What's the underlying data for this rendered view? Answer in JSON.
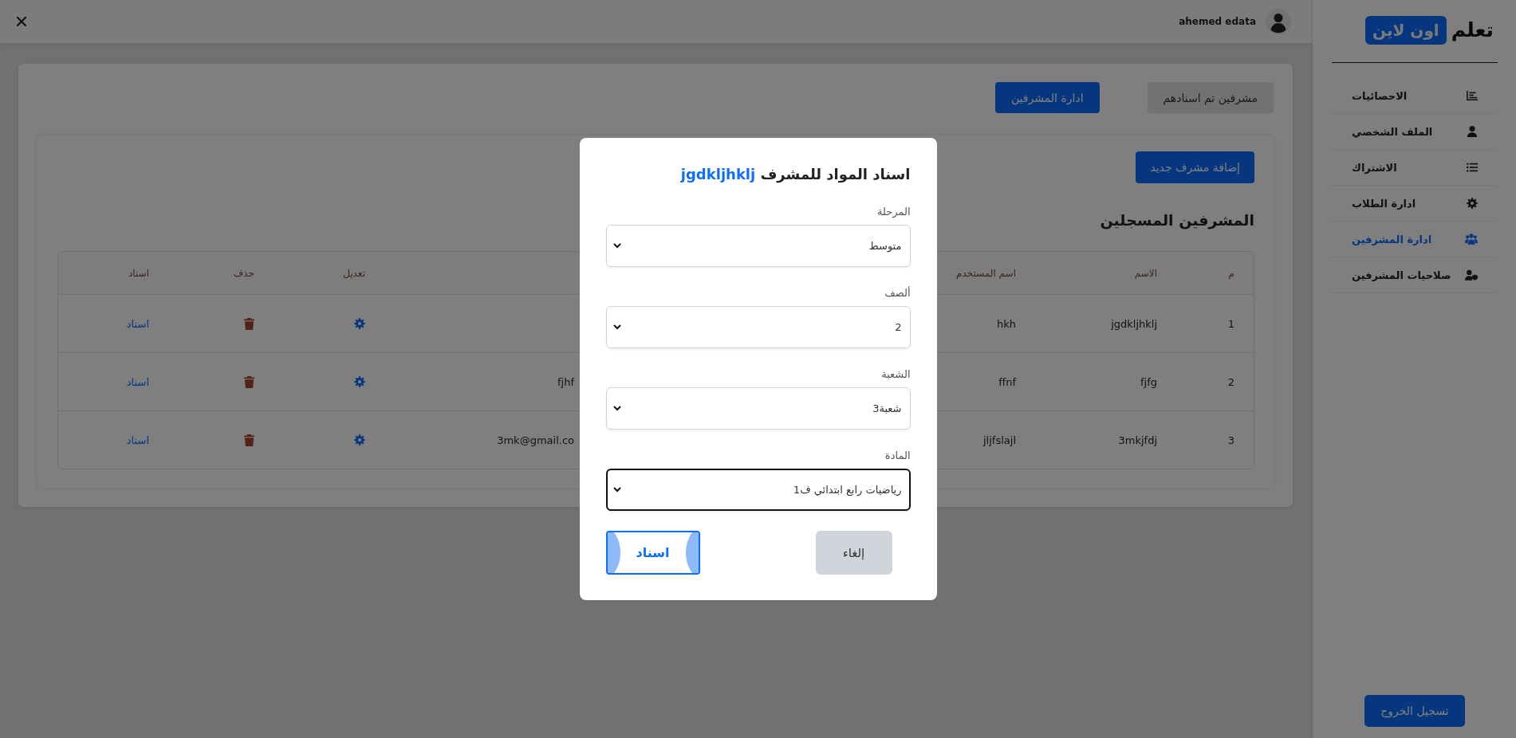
{
  "top_bar": {
    "user_name": "ahemed edata"
  },
  "sidebar": {
    "logo": {
      "word": "تعلم",
      "badge": "اون لاين"
    },
    "items": [
      {
        "label": "الاحصائيات",
        "selected": false
      },
      {
        "label": "الملف الشخصي",
        "selected": false
      },
      {
        "label": "الاشتراك",
        "selected": false
      },
      {
        "label": "ادارة الطلاب",
        "selected": false
      },
      {
        "label": "ادارة المشرفين",
        "selected": true
      },
      {
        "label": "صلاحيات المشرفين",
        "selected": false
      }
    ],
    "logout": "تسجيل الخروج"
  },
  "tabs": [
    {
      "label": "مشرفين تم اسنادهم",
      "selected": false
    },
    {
      "label": "ادارة المشرفين",
      "selected": true
    }
  ],
  "add_button": "إضافة مشرف جديد",
  "heading": "المشرفين المسجلين",
  "table": {
    "columns": [
      "م",
      "الاسم",
      "اسم المستخدم",
      "تعديل",
      "حذف",
      "اسناد"
    ],
    "rows": [
      {
        "number": "1",
        "name": "jgdkljhklj",
        "username": "hkh",
        "action": "اسناد"
      },
      {
        "number": "2",
        "name": "fjfg",
        "username": "ffnf",
        "column_5": "fjhf",
        "action": "اسناد"
      },
      {
        "number": "3",
        "name": "3mkjfdj",
        "username": "jljfslajl",
        "column_5": "3mk@gmail.co",
        "action": "اسناد"
      }
    ]
  },
  "modal": {
    "title": "اسناد المواد للمشرف",
    "supervisor": "jgdkljhklj",
    "fields": [
      {
        "label": "المرحلة",
        "value": "متوسط",
        "focused": false
      },
      {
        "label": "ألصف",
        "value": "2",
        "focused": false
      },
      {
        "label": "الشعبة",
        "value": "شعبة3",
        "focused": false
      },
      {
        "label": "المادة",
        "value": "رياضيات رابع ابتدائي ف1",
        "focused": true
      }
    ],
    "buttons": [
      {
        "label": "إلغاء",
        "kind": "cancel"
      },
      {
        "label": "اسناد",
        "kind": "submit"
      }
    ]
  }
}
